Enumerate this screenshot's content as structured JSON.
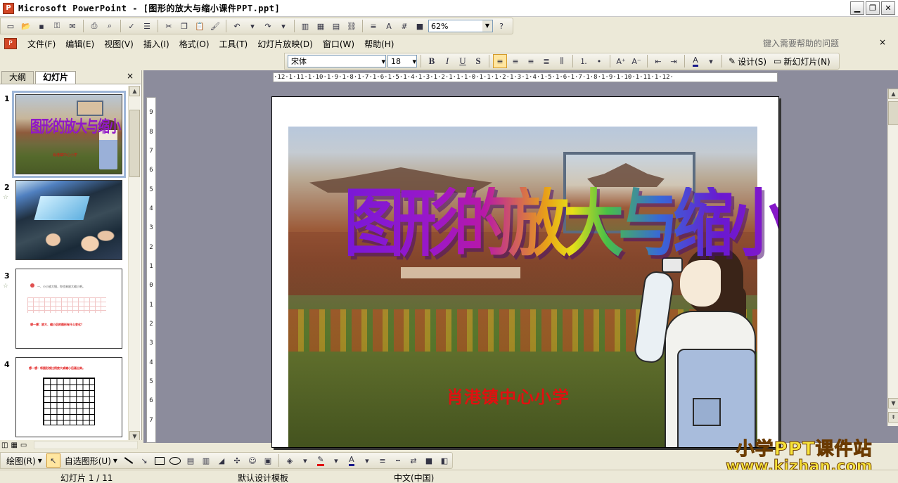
{
  "window": {
    "title": "Microsoft PowerPoint - [图形的放大与缩小课件PPT.ppt]",
    "minimize": "▁",
    "restore": "❐",
    "close": "✕"
  },
  "standard_toolbar": {
    "zoom_value": "62%"
  },
  "menu": {
    "items": [
      "文件(F)",
      "编辑(E)",
      "视图(V)",
      "插入(I)",
      "格式(O)",
      "工具(T)",
      "幻灯片放映(D)",
      "窗口(W)",
      "帮助(H)"
    ],
    "help_search_placeholder": "键入需要帮助的问题",
    "close_glyph": "×"
  },
  "format_toolbar": {
    "font_name": "宋体",
    "font_size": "18",
    "bold": "B",
    "italic": "I",
    "underline": "U",
    "shadow": "S",
    "design_label": "设计(S)",
    "new_slide_label": "新幻灯片(N)"
  },
  "left_pane": {
    "tabs": [
      "大纲",
      "幻灯片"
    ],
    "active_tab": "幻灯片",
    "close_glyph": "×",
    "slides": [
      {
        "number": "1",
        "title": "图形的放大与缩小",
        "subtitle": "肖港镇中心小学",
        "selected": true
      },
      {
        "number": "2",
        "selected": false
      },
      {
        "number": "3",
        "text_line": "一、小小放大镜，你也来放大缩小吧。",
        "red_text": "想一想：放大、缩小后的图形有什么变化？",
        "selected": false
      },
      {
        "number": "4",
        "red_text": "想一想：将图形按比例放大或缩小后画出来。",
        "selected": false
      }
    ]
  },
  "rulers": {
    "horizontal": "·12·1·11·1·10·1·9·1·8·1·7·1·6·1·5·1·4·1·3·1·2·1·1·1·0·1·1·1·2·1·3·1·4·1·5·1·6·1·7·1·8·1·9·1·10·1·11·1·12·",
    "vertical": [
      "9",
      "8",
      "7",
      "6",
      "5",
      "4",
      "3",
      "2",
      "1",
      "0",
      "1",
      "2",
      "3",
      "4",
      "5",
      "6",
      "7"
    ]
  },
  "slide": {
    "title": "图形的放大与缩小",
    "subtitle": "肖港镇中心小学"
  },
  "drawing_toolbar": {
    "draw_label": "绘图(R)",
    "autoshapes_label": "自选图形(U)"
  },
  "status_bar": {
    "slide_position": "幻灯片 1 / 11",
    "design_template": "默认设计模板",
    "language": "中文(中国)"
  },
  "watermark": {
    "line1": "小学PPT课件站",
    "line2": "www.kjzhan.com"
  }
}
